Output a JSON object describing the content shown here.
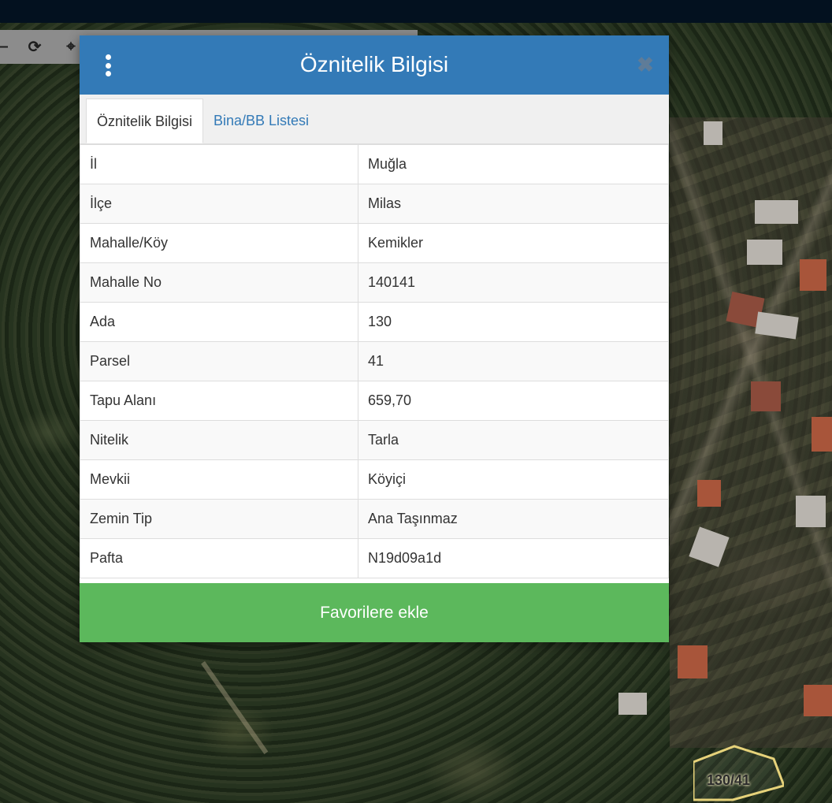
{
  "modal": {
    "title": "Öznitelik Bilgisi",
    "tabs": [
      {
        "label": "Öznitelik Bilgisi",
        "active": true
      },
      {
        "label": "Bina/BB Listesi",
        "active": false
      }
    ],
    "rows": [
      {
        "key": "İl",
        "value": "Muğla"
      },
      {
        "key": "İlçe",
        "value": "Milas"
      },
      {
        "key": "Mahalle/Köy",
        "value": "Kemikler"
      },
      {
        "key": "Mahalle No",
        "value": "140141"
      },
      {
        "key": "Ada",
        "value": "130"
      },
      {
        "key": "Parsel",
        "value": "41"
      },
      {
        "key": "Tapu Alanı",
        "value": "659,70"
      },
      {
        "key": "Nitelik",
        "value": "Tarla"
      },
      {
        "key": "Mevkii",
        "value": "Köyiçi"
      },
      {
        "key": "Zemin Tip",
        "value": "Ana Taşınmaz"
      },
      {
        "key": "Pafta",
        "value": "N19d09a1d"
      }
    ],
    "favorite_button": "Favorilere ekle",
    "header_color": "#337ab7",
    "button_color": "#5cb85c"
  },
  "map": {
    "parcel_label": "130/41"
  },
  "toolbar": {
    "icons": [
      "minus-icon",
      "refresh-icon",
      "crosshair-icon"
    ]
  }
}
